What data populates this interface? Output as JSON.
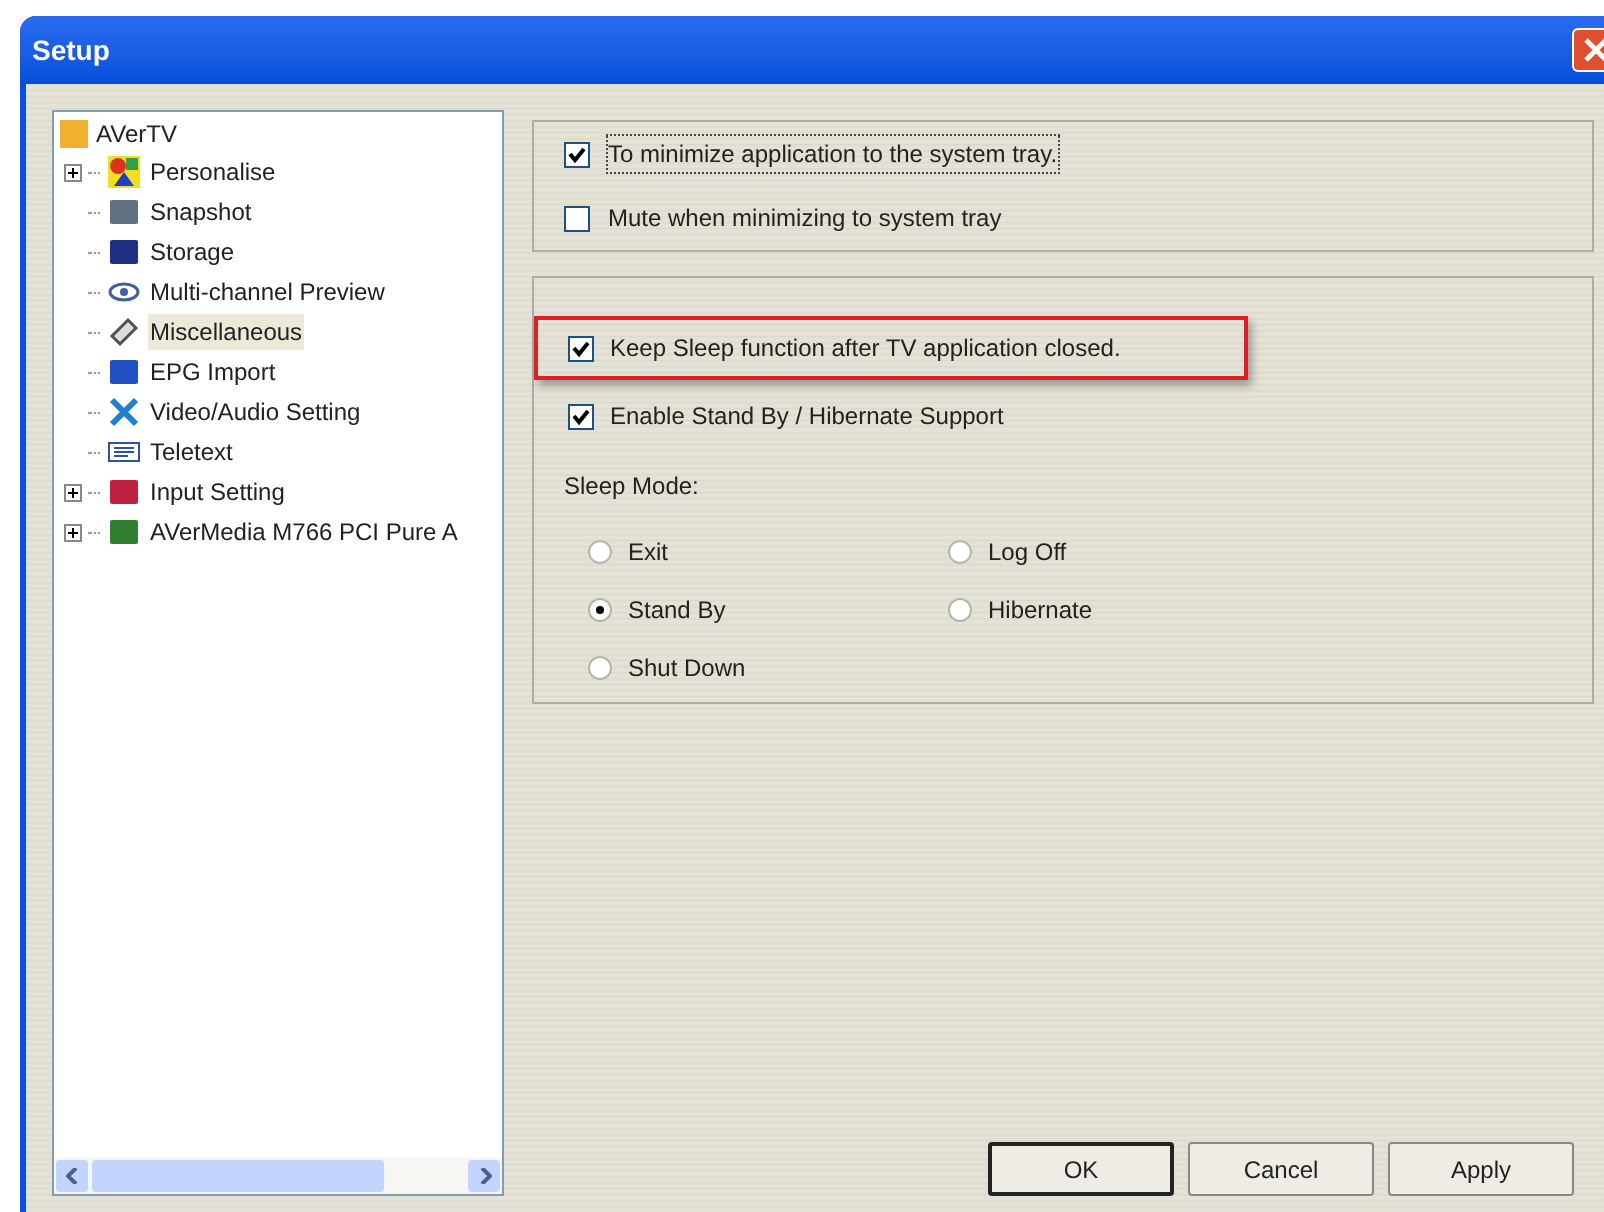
{
  "window": {
    "title": "Setup"
  },
  "tree": {
    "label": "AVerTV",
    "children": [
      {
        "label": "Personalise",
        "expanded": false,
        "selected": false
      },
      {
        "label": "Snapshot",
        "selected": false
      },
      {
        "label": "Storage",
        "selected": false
      },
      {
        "label": "Multi-channel Preview",
        "selected": false
      },
      {
        "label": "Miscellaneous",
        "selected": true
      },
      {
        "label": "EPG Import",
        "selected": false
      },
      {
        "label": "Video/Audio Setting",
        "selected": false
      },
      {
        "label": "Teletext",
        "selected": false
      },
      {
        "label": "Input Setting",
        "expanded": false,
        "selected": false
      },
      {
        "label": "AVerMedia M766 PCI Pure A",
        "expanded": false,
        "selected": false
      }
    ]
  },
  "tray_options": [
    {
      "label": "To minimize application to the system tray.",
      "checked": true,
      "focused": true
    },
    {
      "label": "Mute when minimizing to system tray",
      "checked": false,
      "focused": false
    }
  ],
  "sleep_options": [
    {
      "label": "Keep Sleep function after TV application closed.",
      "checked": true,
      "highlighted": true
    },
    {
      "label": "Enable Stand By / Hibernate Support",
      "checked": true,
      "highlighted": false
    }
  ],
  "sleep_mode": {
    "label": "Sleep Mode:",
    "options": [
      {
        "label": "Exit",
        "selected": false
      },
      {
        "label": "Log Off",
        "selected": false
      },
      {
        "label": "Stand By",
        "selected": true
      },
      {
        "label": "Hibernate",
        "selected": false
      },
      {
        "label": "Shut Down",
        "selected": false
      }
    ]
  },
  "buttons": [
    {
      "label": "OK",
      "default": true
    },
    {
      "label": "Cancel",
      "default": false
    },
    {
      "label": "Apply",
      "default": false
    }
  ]
}
